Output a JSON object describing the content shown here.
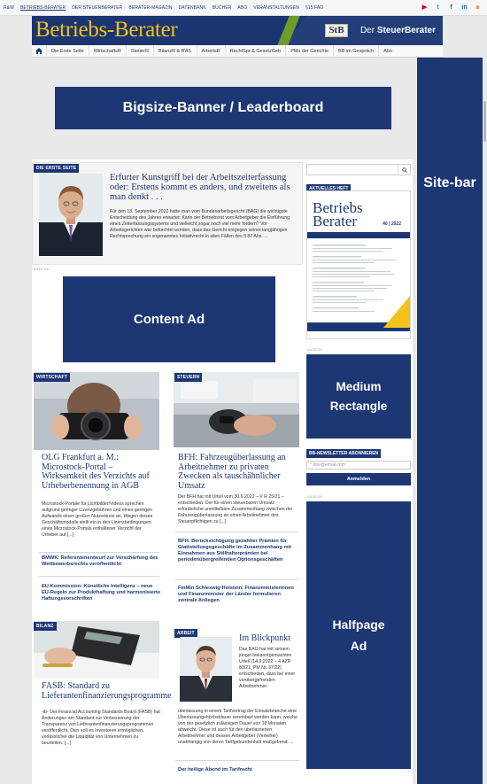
{
  "topbar": {
    "links": [
      "R&W",
      "BETRIEBS-BERATER",
      "DER STEUERBERATER",
      "BERATER-MAGAZIN",
      "DATENBANK",
      "BÜCHER",
      "ABO",
      "VERANSTALTUNGEN",
      "§15 FAO"
    ],
    "social_icons": [
      "youtube-icon",
      "twitter-icon",
      "facebook-icon",
      "linkedin-icon",
      "rss-icon"
    ]
  },
  "header": {
    "logo": "Betriebs-Berater",
    "stb_badge": "StB",
    "stb_text_prefix": "Der ",
    "stb_text_bold": "SteuerBerater"
  },
  "nav": {
    "items": [
      "Die Erste Seite",
      "WirtschaftsR",
      "SteuerR",
      "BilanzR & BWL",
      "ArbeitsR",
      "RechtSpr & GesetzGeb",
      "PMs der Gerichte",
      "BB im Gespräch",
      "Abo"
    ]
  },
  "ads": {
    "leaderboard": "Bigsize-Banner / Leaderboard",
    "sitebar": "Site-bar",
    "content": "Content Ad",
    "medium": "Medium Rectangle",
    "halfpage": "Halfpage Ad",
    "anzeige": "ANZEIGE"
  },
  "erste_seite": {
    "kicker": "DIE ERSTE SEITE",
    "headline": "Erfurter Kunstgriff bei der Arbeitszeiterfassung oder: Erstens kommt es anders, und zweitens als man denkt . . .",
    "body": "Für den 13. September 2022 hatte man vom Bundesarbeitsgericht (BAG) die wichtigste Entscheidung des Jahres erwartet: Kann der Betriebsrat vom Arbeitgeber die Einführung eines Zeiterfassungssystems und vielleicht sogar noch viel mehr fordern? Vor Arbeitsgerichten war befürchtet worden, dass das Gericht entgegen seiner langjährigen Rechtsprechung ein sogenanntes Initiativrecht in allen Fällen des § 87 Abs. ..."
  },
  "wirtschaft": {
    "kicker": "WIRTSCHAFT",
    "headline": "OLG Frankfurt a. M.: Microstock-Portal – Wirksamkeit des Verzichts auf Urheberbenennung in AGB",
    "body": "Microstock-Portale für Lichtbilder/Videos sprechen aufgrund geringer Lizenzgebühren und eines geringen Aufwands einen großen Nutzerkreis an. Wegen dieses Geschäftsmodells stellt ein in den Lizenzbedingungen eines Microstock-Portals enthaltener Verzicht der Urheber auf [...]",
    "links": [
      "BMWK: Referentenentwurf zur Verschärfung des Wettbewerbsrechts veröffentlicht",
      "EU-Kommission: Künstliche Intelligenz – neue EU-Regeln zur Produkthaftung und harmonisierte Haftungsvorschriften"
    ]
  },
  "steuern": {
    "kicker": "STEUERN",
    "headline": "BFH: Fahrzeugüberlassung an Arbeitnehmer zu privaten Zwecken als tauschähnlicher Umsatz",
    "body": "Der BFH hat mit Urteil vom 30.6.2022 – V R 25/21 – entschieden: Der für einen steuerbaren Umsatz erforderliche unmittelbare Zusammenhang zwischen der Fahrzeugüberlassung an einen Arbeitnehmer des Steuerpflichtigen zu [...]",
    "links": [
      "BFH: Berücksichtigung gezahlter Prämien für Glattstellungsgeschäfte im Zusammenhang mit Einnahmen aus Stillhalterprämien bei periodenübergreifenden Optionsgeschäften",
      "FinMin Schleswig-Holstein: Finanzministerinnen und Finanzminister der Länder formulieren zentrale Anliegen"
    ]
  },
  "bilanz": {
    "kicker": "BILANZ",
    "headline": "FASB: Standard zu Lieferantenfinanzierungsprogramme",
    "body": "-tb- Der Financial Accounting Standards Board (FASB) hat Änderungen am Standard zur Verbesserung der Transparenz von Lieferantenfinanzierungsprogrammen veröffentlicht. Dies soll es Investoren ermöglichen, verlässlicher die Liquidität von Unternehmen zu beurteilen. [...]"
  },
  "arbeit": {
    "kicker": "ARBEIT",
    "headline": "Im Blickpunkt",
    "body_top": "Das BAG hat mit seinem jüngst bekanntgemachten Urteil (14.9.2022 – 4 AZR 83/21, PM Nr. 37/22) entschieden, dass bei einer vorübergehenden Arbeitnehmer-",
    "body_bottom": "überlassung in einem Tarifvertrag der Einsatzbranche eine Überlassungshöchstdauer vereinbart werden kann, welche von der gesetzlich zulässigen Dauer von 18 Monaten abweicht. Diese ist auch für den überlassenen Arbeitnehmer und dessen Arbeitgeber (Verleiher) unabhängig von deren Tarifgebundenheit maßgebend. ...",
    "link": "Der heilige Abend im Tarifrecht"
  },
  "sidebar": {
    "search_button_icon": "search-icon",
    "aktuelles_heft": "AKTUELLES HEFT",
    "magazine_title_1": "Betriebs",
    "magazine_title_2": "Berater",
    "magazine_issue": "40 | 2022",
    "newsletter_title": "BB-NEWSLETTER ABONNIEREN",
    "newsletter_placeholder": "* Ihre@email.com",
    "newsletter_button": "Anmelden"
  }
}
